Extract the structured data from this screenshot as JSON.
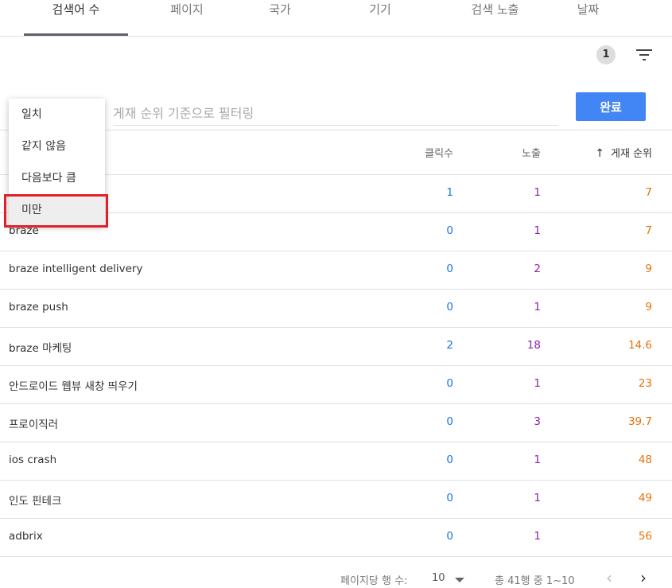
{
  "tabs": [
    {
      "label": "검색어 수"
    },
    {
      "label": "페이지"
    },
    {
      "label": "국가"
    },
    {
      "label": "기기"
    },
    {
      "label": "검색 노출"
    },
    {
      "label": "날짜"
    }
  ],
  "toolbar": {
    "filter_count": "1",
    "filter_icon": "filter-list-icon"
  },
  "filter": {
    "placeholder": "게재 순위 기준으로 필터링",
    "value": "",
    "done_label": "완료"
  },
  "dropdown": {
    "items": [
      {
        "label": "일치"
      },
      {
        "label": "같지 않음"
      },
      {
        "label": "다음보다 큼"
      },
      {
        "label": "미만"
      }
    ],
    "selected": "미만"
  },
  "table": {
    "headers": {
      "clicks": "클릭수",
      "impressions": "노출",
      "position": "게재 순위",
      "sort_icon": "arrow-up-icon"
    },
    "rows": [
      {
        "query": "",
        "clicks": "1",
        "impressions": "1",
        "position": "7"
      },
      {
        "query": "braze",
        "clicks": "0",
        "impressions": "1",
        "position": "7"
      },
      {
        "query": "braze intelligent delivery",
        "clicks": "0",
        "impressions": "2",
        "position": "9"
      },
      {
        "query": "braze push",
        "clicks": "0",
        "impressions": "1",
        "position": "9"
      },
      {
        "query": "braze 마케팅",
        "clicks": "2",
        "impressions": "18",
        "position": "14.6"
      },
      {
        "query": "안드로이드 웹뷰 새창 띄우기",
        "clicks": "0",
        "impressions": "1",
        "position": "23"
      },
      {
        "query": "프로이직러",
        "clicks": "0",
        "impressions": "3",
        "position": "39.7"
      },
      {
        "query": "ios crash",
        "clicks": "0",
        "impressions": "1",
        "position": "48"
      },
      {
        "query": "인도 핀테크",
        "clicks": "0",
        "impressions": "1",
        "position": "49"
      },
      {
        "query": "adbrix",
        "clicks": "0",
        "impressions": "1",
        "position": "56"
      }
    ]
  },
  "pagination": {
    "rows_per_page_label": "페이지당 행 수:",
    "rows_per_page": "10",
    "range": "총 41행 중 1~10"
  },
  "colors": {
    "accent": "#4285f4",
    "clicks": "#1a73e8",
    "impressions": "#8e24aa",
    "position": "#e8710a",
    "highlight": "#e0212b"
  }
}
